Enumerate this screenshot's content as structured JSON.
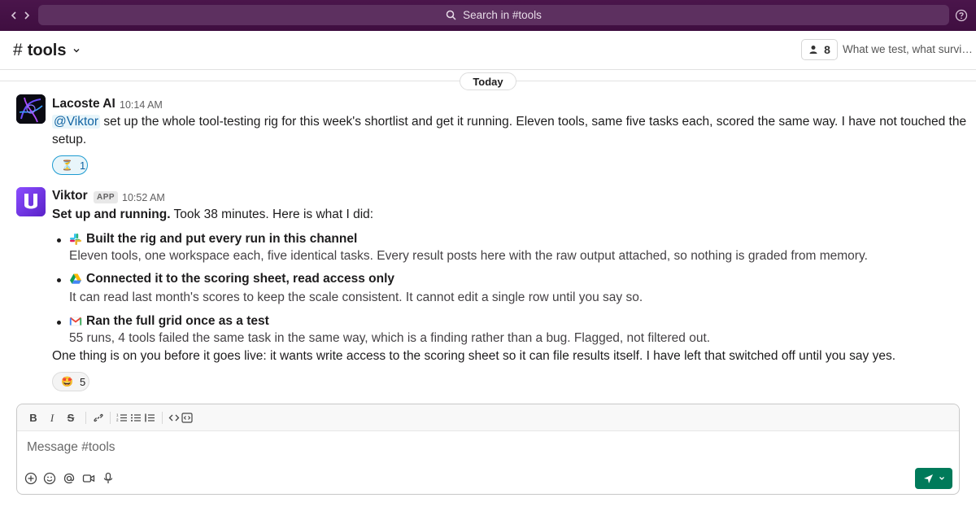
{
  "topbar": {
    "search_placeholder": "Search in #tools",
    "icons": [
      "back-arrow-icon",
      "forward-arrow-icon",
      "search-icon",
      "help-icon"
    ],
    "bg_color": "#3f0e40"
  },
  "channel": {
    "hash": "#",
    "name": "tools",
    "member_count": "8",
    "topic": "What we test, what survives"
  },
  "divider": {
    "label": "Today"
  },
  "messages": [
    {
      "author": "Lacoste AI",
      "time": "10:14 AM",
      "mention": "@Viktor",
      "text_line1": " set up the whole tool-testing rig for this week's shortlist and get it running. Eleven tools, same five tasks each, scored the same way. I have not touched the",
      "text_line2": "setup.",
      "reaction": {
        "emoji": "⏳",
        "count": "1"
      }
    },
    {
      "author": "Viktor",
      "badge": "APP",
      "time": "10:52 AM",
      "intro_bold": "Set up and running.",
      "intro_rest": " Took 38 minutes. Here is what I did:",
      "bullets": [
        {
          "icon": "slack-icon",
          "title": "Built the rig and put every run in this channel",
          "detail": "Eleven tools, one workspace each, five identical tasks. Every result posts here with the raw output attached, so nothing is graded from memory."
        },
        {
          "icon": "google-drive-icon",
          "title": "Connected it to the scoring sheet, read access only",
          "detail": "It can read last month's scores to keep the scale consistent. It cannot edit a single row until you say so."
        },
        {
          "icon": "gmail-icon",
          "title": "Ran the full grid once as a test",
          "detail": "55 runs, 4 tools failed the same task in the same way, which is a finding rather than a bug. Flagged, not filtered out."
        }
      ],
      "closing": "One thing is on you before it goes live: it wants write access to the scoring sheet so it can file results itself. I have left that switched off until you say yes.",
      "reaction": {
        "emoji": "🤩",
        "count": "5"
      }
    }
  ],
  "composer": {
    "placeholder": "Message #tools",
    "format_buttons": [
      "B",
      "I",
      "S"
    ],
    "format_icons": [
      "link-icon",
      "ordered-list-icon",
      "bulleted-list-icon",
      "blockquote-icon",
      "code-icon",
      "code-block-icon"
    ],
    "tool_icons": [
      "plus-icon",
      "emoji-icon",
      "mention-icon",
      "video-icon",
      "microphone-icon"
    ],
    "send_color": "#007a5a"
  }
}
